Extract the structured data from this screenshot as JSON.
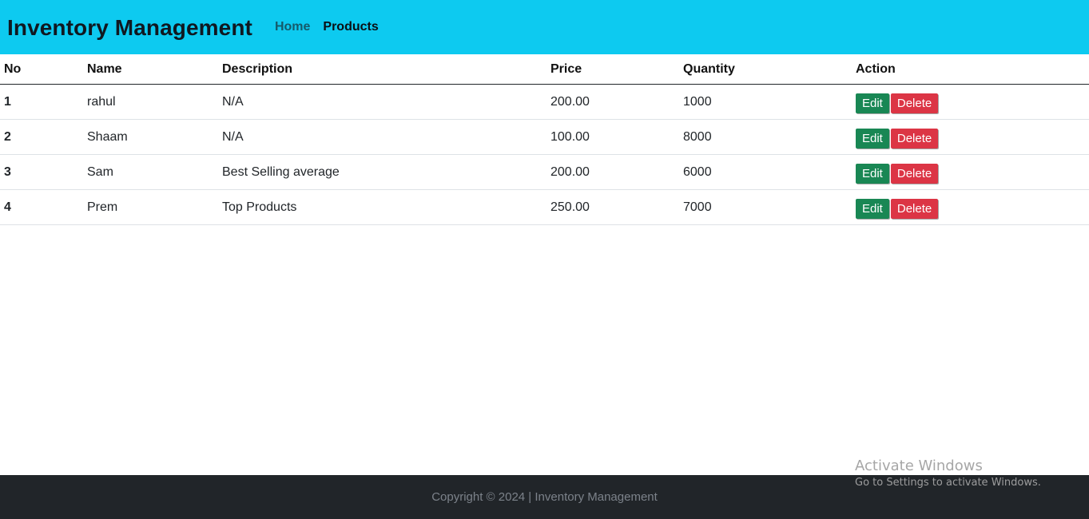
{
  "navbar": {
    "brand": "Inventory Management",
    "links": [
      {
        "label": "Home"
      },
      {
        "label": "Products"
      }
    ],
    "background_color": "#0dcaf0"
  },
  "table": {
    "headers": [
      "No",
      "Name",
      "Description",
      "Price",
      "Quantity",
      "Action"
    ],
    "rows": [
      {
        "no": "1",
        "name": "rahul",
        "description": "N/A",
        "price": "200.00",
        "quantity": "1000"
      },
      {
        "no": "2",
        "name": "Shaam",
        "description": "N/A",
        "price": "100.00",
        "quantity": "8000"
      },
      {
        "no": "3",
        "name": "Sam",
        "description": "Best Selling average",
        "price": "200.00",
        "quantity": "6000"
      },
      {
        "no": "4",
        "name": "Prem",
        "description": "Top Products",
        "price": "250.00",
        "quantity": "7000"
      }
    ],
    "actions": {
      "edit_label": "Edit",
      "delete_label": "Delete",
      "edit_color": "#198754",
      "delete_color": "#dc3545"
    }
  },
  "footer": {
    "text": "Copyright © 2024 | Inventory Management"
  },
  "watermark": {
    "title": "Activate Windows",
    "subtitle": "Go to Settings to activate Windows."
  }
}
